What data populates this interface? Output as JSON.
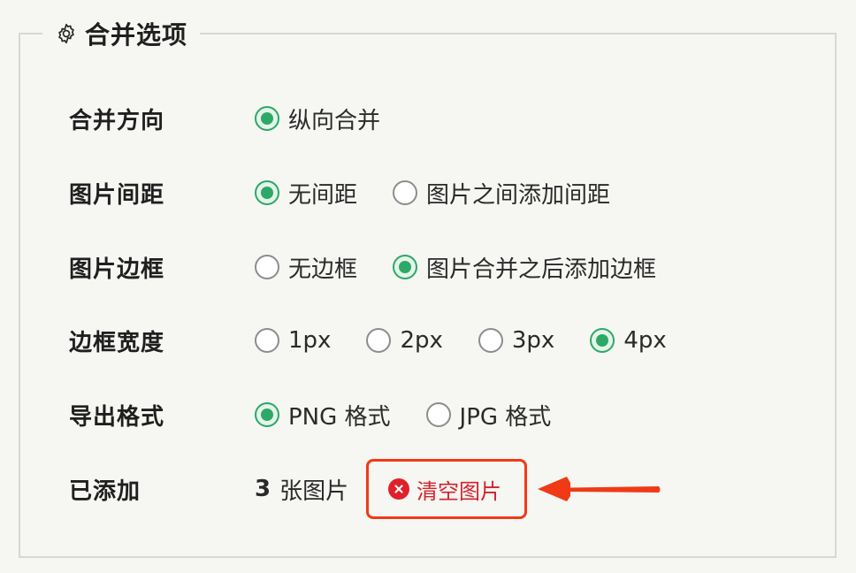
{
  "section": {
    "title": "合并选项",
    "icon": "gear-icon"
  },
  "rows": [
    {
      "label": "合并方向",
      "options": [
        {
          "label": "纵向合并",
          "checked": true
        }
      ]
    },
    {
      "label": "图片间距",
      "options": [
        {
          "label": "无间距",
          "checked": true
        },
        {
          "label": "图片之间添加间距",
          "checked": false
        }
      ]
    },
    {
      "label": "图片边框",
      "options": [
        {
          "label": "无边框",
          "checked": false
        },
        {
          "label": "图片合并之后添加边框",
          "checked": true
        }
      ]
    },
    {
      "label": "边框宽度",
      "options": [
        {
          "label": "1px",
          "checked": false
        },
        {
          "label": "2px",
          "checked": false
        },
        {
          "label": "3px",
          "checked": false
        },
        {
          "label": "4px",
          "checked": true
        }
      ]
    },
    {
      "label": "导出格式",
      "options": [
        {
          "label": "PNG 格式",
          "checked": true
        },
        {
          "label": "JPG 格式",
          "checked": false
        }
      ]
    }
  ],
  "added": {
    "label": "已添加",
    "count": "3",
    "unit": "张图片",
    "clear_label": "清空图片",
    "clear_icon": "close-circle-icon"
  },
  "colors": {
    "accent_green": "#2ea866",
    "highlight_red": "#f03a16",
    "danger_text": "#d4212a"
  }
}
